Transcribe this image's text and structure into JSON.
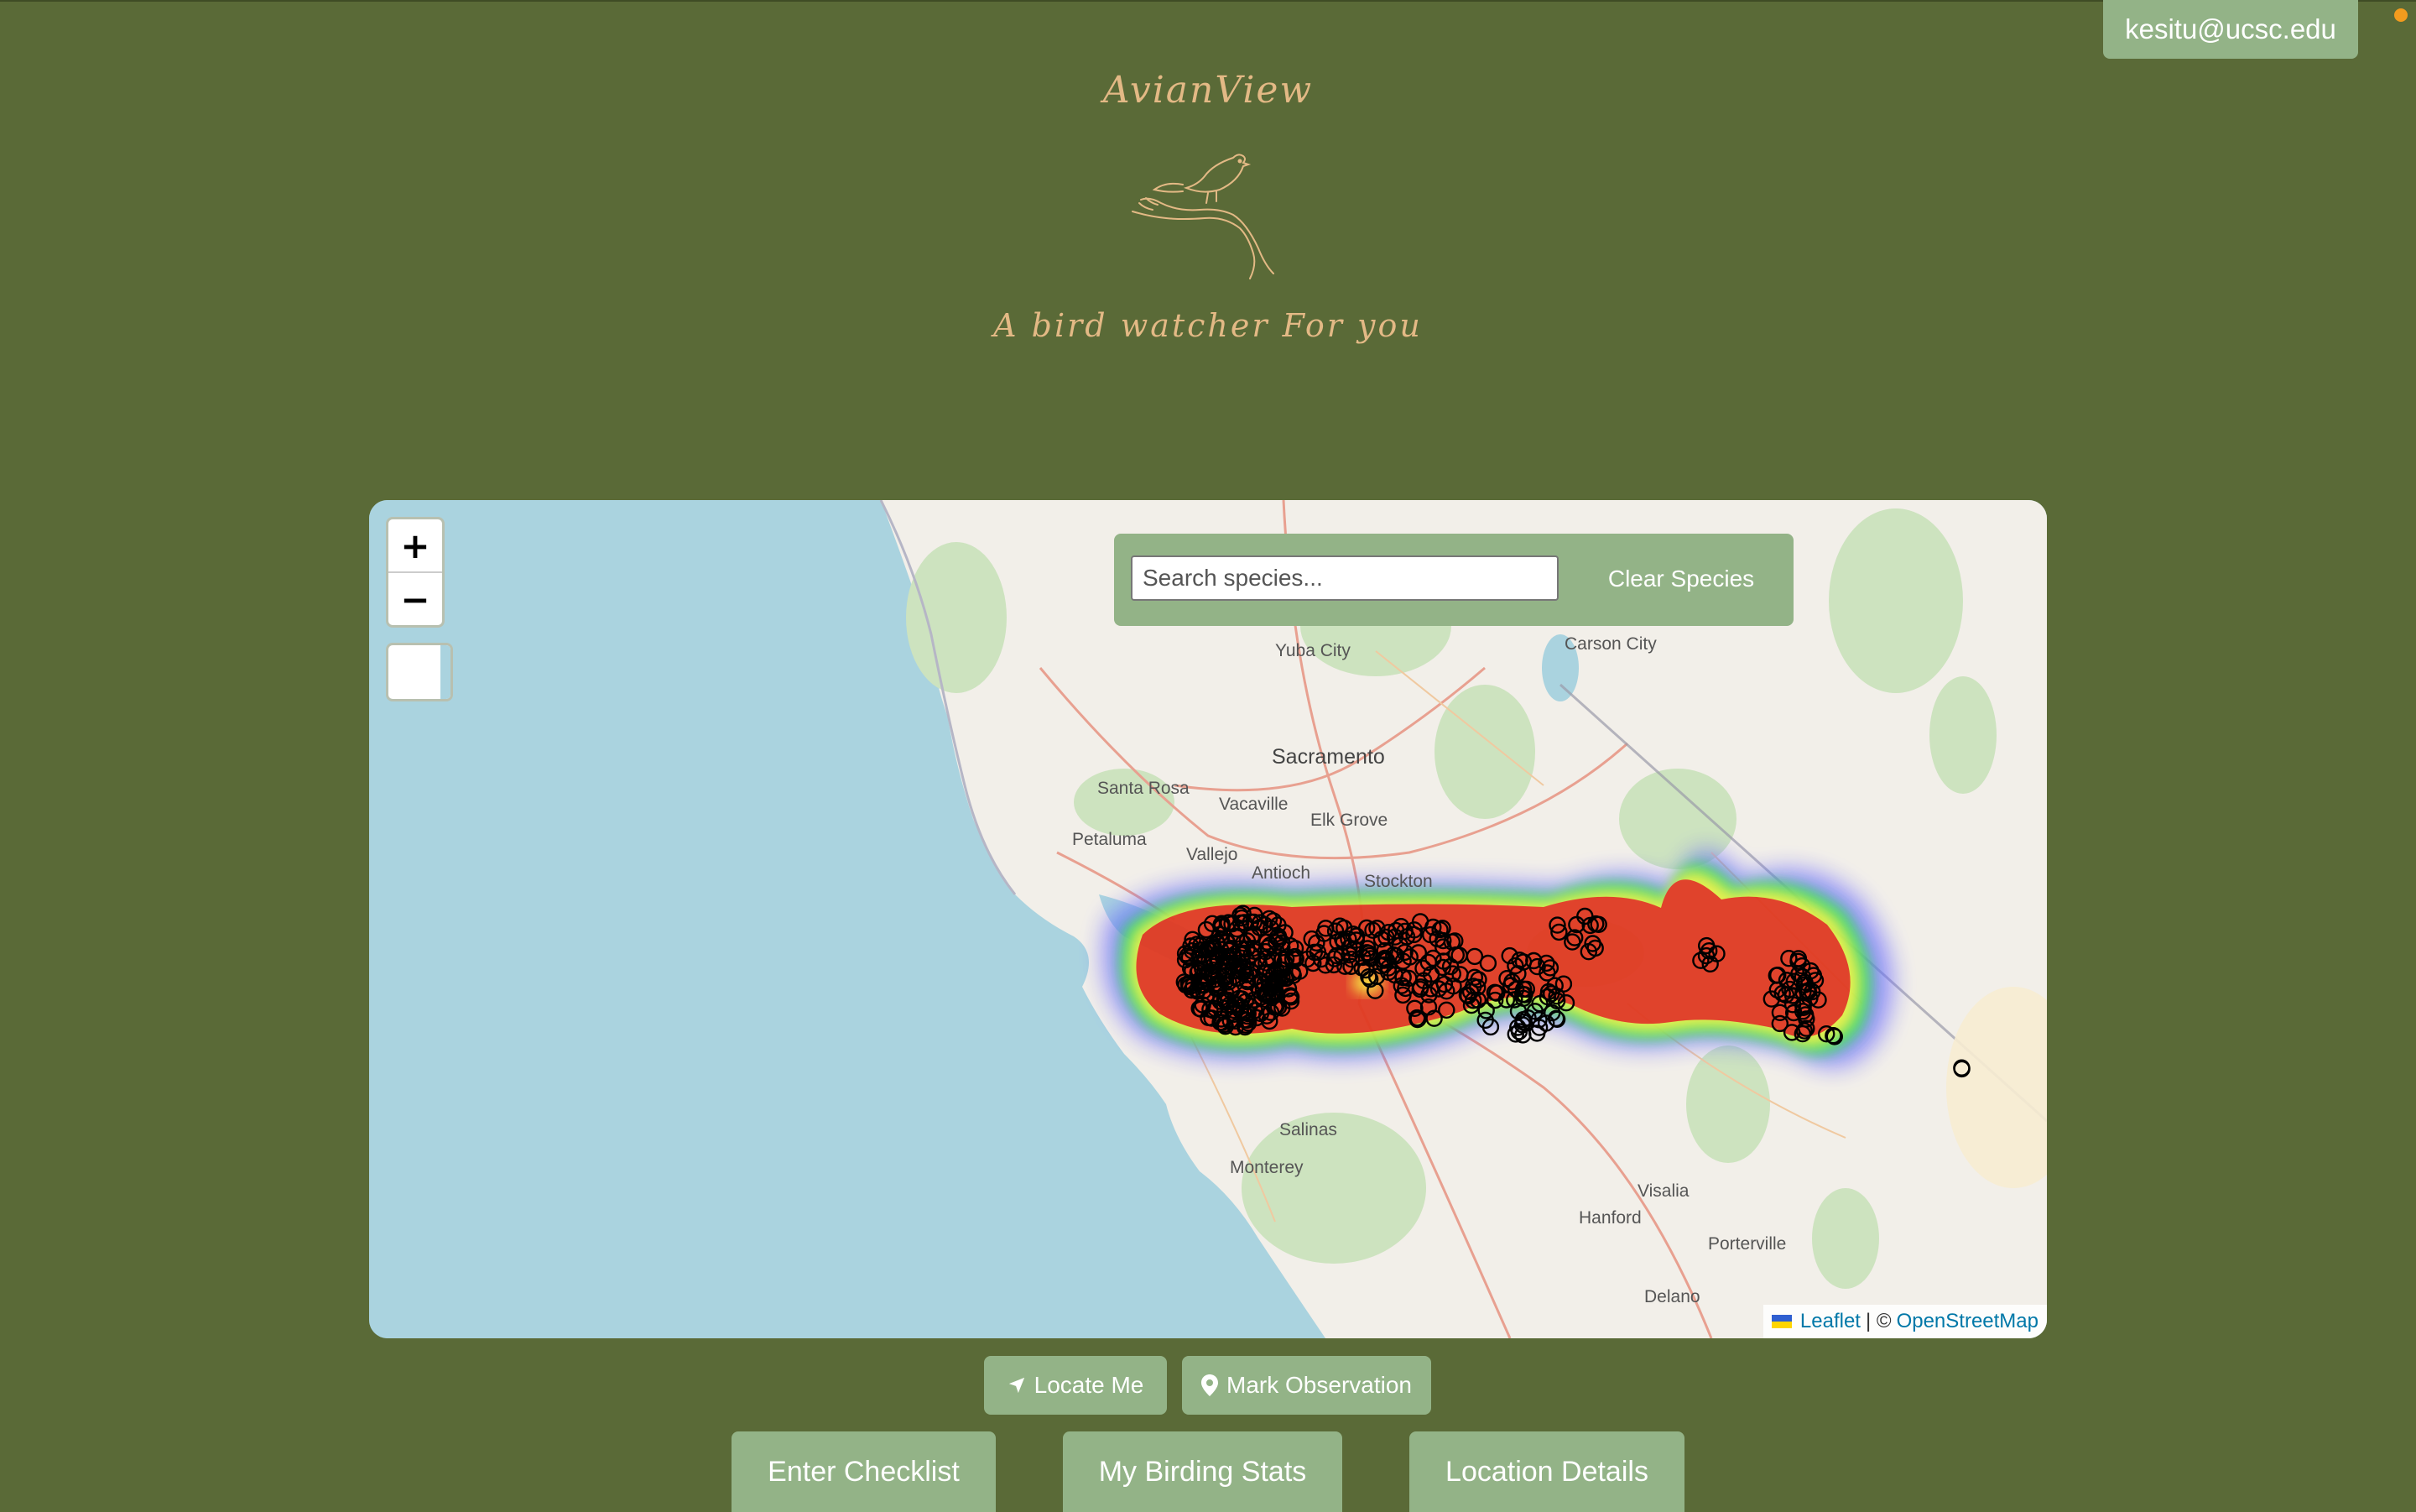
{
  "header": {
    "user_email": "kesitu@ucsc.edu",
    "app_title": "AvianView",
    "tagline": "A bird watcher For you"
  },
  "map": {
    "zoom_in": "+",
    "zoom_out": "−",
    "search": {
      "placeholder": "Search species...",
      "value": ""
    },
    "clear_label": "Clear Species",
    "attribution": {
      "leaflet": "Leaflet",
      "separator": "| ©",
      "osm": "OpenStreetMap"
    },
    "places": [
      "Carson City",
      "Yuba City",
      "Sacramento",
      "Santa Rosa",
      "Vacaville",
      "Elk Grove",
      "Petaluma",
      "Vallejo",
      "Antioch",
      "Stockton",
      "Salinas",
      "Monterey",
      "Visalia",
      "Hanford",
      "Porterville",
      "Delano"
    ],
    "layer": "heatmap"
  },
  "actions": {
    "locate": "Locate Me",
    "mark": "Mark Observation",
    "checklist": "Enter Checklist",
    "stats": "My Birding Stats",
    "location": "Location Details"
  },
  "colors": {
    "background": "#5a6a37",
    "button": "#93b387",
    "accent_text": "#e3b985",
    "water": "#aad3df",
    "land": "#f2efe9"
  }
}
